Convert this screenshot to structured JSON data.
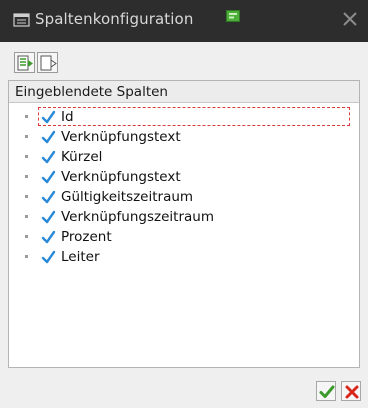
{
  "dialog": {
    "title": "Spaltenkonfiguration"
  },
  "panel": {
    "header": "Eingeblendete Spalten",
    "items": [
      {
        "label": "Id",
        "checked": true,
        "focused": true
      },
      {
        "label": "Verknüpfungstext",
        "checked": true
      },
      {
        "label": "Kürzel",
        "checked": true
      },
      {
        "label": "Verknüpfungstext",
        "checked": true
      },
      {
        "label": "Gültigkeitszeitraum",
        "checked": true
      },
      {
        "label": "Verknüpfungszeitraum",
        "checked": true
      },
      {
        "label": "Prozent",
        "checked": true
      },
      {
        "label": "Leiter",
        "checked": true
      }
    ]
  },
  "icons": {
    "title": "window-list-icon",
    "badge": "green-indicator-icon",
    "close": "close-icon",
    "toolbar_1": "show-columns-icon",
    "toolbar_2": "hide-columns-icon",
    "ok": "green-checkmark-icon",
    "cancel": "red-x-icon",
    "checkbox": "blue-checkmark-icon"
  },
  "colors": {
    "titlebar": "#2d2d2d",
    "check": "#2a8ad8",
    "ok": "#3a9a2a",
    "cancel": "#d8281c",
    "focus": "#d63a3a"
  }
}
